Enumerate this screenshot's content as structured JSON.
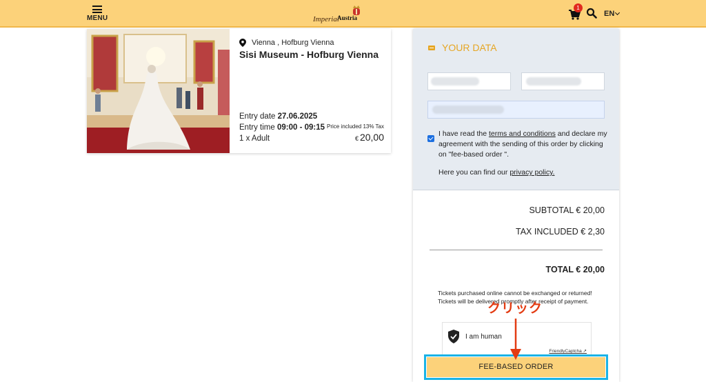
{
  "header": {
    "menu_label": "MENU",
    "logo_script": "Imperial",
    "logo_brand": "Austria",
    "cart_count": "1",
    "language": "EN"
  },
  "product": {
    "location": "Vienna , Hofburg Vienna",
    "title": "Sisi Museum - Hofburg Vienna",
    "entry_date_label": "Entry date",
    "entry_date": "27.06.2025",
    "entry_time_label": "Entry time",
    "entry_time": "09:00 - 09:15",
    "tax_note": "Price included 13% Tax",
    "quantity": "1 x Adult",
    "currency": "€",
    "price": "20,00"
  },
  "form": {
    "section_title": "YOUR DATA",
    "agree_pre": "I have read the ",
    "terms_link": "terms and conditions",
    "agree_post": " and declare my agreement with the sending of this order by clicking on \"fee-based order \".",
    "privacy_pre": "Here you can find our ",
    "privacy_link": "privacy policy."
  },
  "summary": {
    "subtotal": "SUBTOTAL € 20,00",
    "tax": "TAX INCLUDED € 2,30",
    "total": "TOTAL € 20,00",
    "note_line1": "Tickets purchased online cannot be exchanged or returned!",
    "note_line2": "Tickets will be delivered promptly after receipt of payment."
  },
  "captcha": {
    "label": "I am human",
    "provider": "FriendlyCaptcha ↗"
  },
  "order_button": "FEE-BASED ORDER",
  "annotation": "クリック",
  "colors": {
    "header_bg": "#fcd27a",
    "accent": "#e6a623",
    "button_bg": "#fcd27a",
    "highlight": "#1ab3e6",
    "annotation": "#e33b12"
  }
}
